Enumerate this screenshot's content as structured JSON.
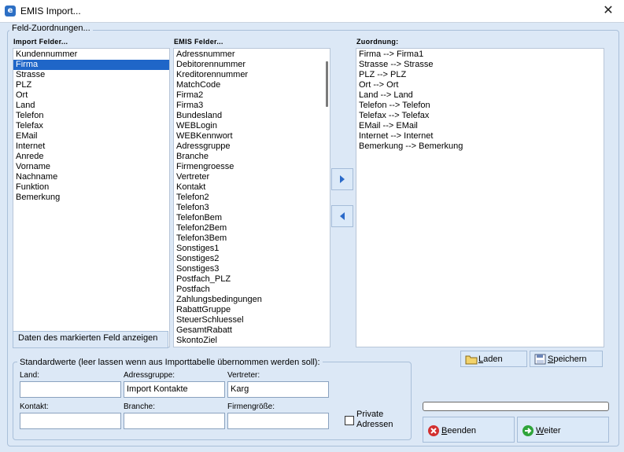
{
  "window": {
    "title": "EMIS Import...",
    "close_glyph": "✕",
    "app_icon": "e"
  },
  "field_mapping": {
    "group_title": "Feld-Zuordnungen...",
    "import_label": "Import Felder...",
    "emis_label": "EMIS Felder...",
    "mapping_label": "Zuordnung:",
    "import_fields": [
      "Kundennummer",
      "Firma",
      "Strasse",
      "PLZ",
      "Ort",
      "Land",
      "Telefon",
      "Telefax",
      "EMail",
      "Internet",
      "Anrede",
      "Vorname",
      "Nachname",
      "Funktion",
      "Bemerkung"
    ],
    "import_selected": "Firma",
    "emis_fields": [
      "Adressnummer",
      "Debitorennummer",
      "Kreditorennummer",
      "MatchCode",
      "Firma2",
      "Firma3",
      "Bundesland",
      "WEBLogin",
      "WEBKennwort",
      "Adressgruppe",
      "Branche",
      "Firmengroesse",
      "Vertreter",
      "Kontakt",
      "Telefon2",
      "Telefon3",
      "TelefonBem",
      "Telefon2Bem",
      "Telefon3Bem",
      "Sonstiges1",
      "Sonstiges2",
      "Sonstiges3",
      "Postfach_PLZ",
      "Postfach",
      "Zahlungsbedingungen",
      "RabattGruppe",
      "SteuerSchluessel",
      "GesamtRabatt",
      "SkontoZiel"
    ],
    "mappings": [
      "Firma --> Firma1",
      "Strasse --> Strasse",
      "PLZ --> PLZ",
      "Ort --> Ort",
      "Land --> Land",
      "Telefon --> Telefon",
      "Telefax --> Telefax",
      "EMail --> EMail",
      "Internet --> Internet",
      "Bemerkung --> Bemerkung"
    ],
    "info_text": "Daten des markierten Feld anzeigen"
  },
  "defaults": {
    "group_title": "Standardwerte (leer lassen wenn aus Importtabelle übernommen werden soll):",
    "land_label": "Land:",
    "adressgruppe_label": "Adressgruppe:",
    "vertreter_label": "Vertreter:",
    "kontakt_label": "Kontakt:",
    "branche_label": "Branche:",
    "firmengroesse_label": "Firmengröße:",
    "land_value": "",
    "adressgruppe_value": "Import Kontakte",
    "vertreter_value": "Karg",
    "kontakt_value": "",
    "branche_value": "",
    "firmengroesse_value": "",
    "private_label_1": "Private",
    "private_label_2": "Adressen",
    "private_checked": false
  },
  "buttons": {
    "laden_first": "L",
    "laden_rest": "aden",
    "speichern_first": "S",
    "speichern_rest": "peichern",
    "beenden_first": "B",
    "beenden_rest": "eenden",
    "weiter_first": "W",
    "weiter_rest": "eiter"
  },
  "progress": {
    "value": 0
  },
  "colors": {
    "accent": "#1f66c8",
    "background": "#dce8f6",
    "arrow": "#2a6ac9",
    "exit_red": "#d23030",
    "go_green": "#2fa43a"
  }
}
